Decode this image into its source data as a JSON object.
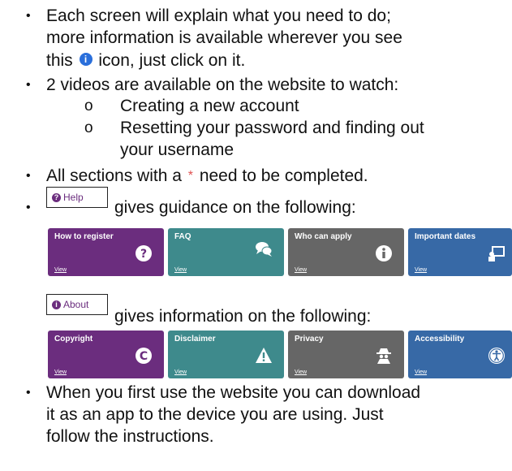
{
  "bullets": {
    "b1_line1": "Each screen will explain what you need to do;",
    "b1_line2": "more information is available wherever you see",
    "b1_line3a": "this",
    "b1_line3b": "icon, just click on it.",
    "b2": "2 videos are available on the website to watch:",
    "b2_sub1": "Creating a new account",
    "b2_sub2_line1": "Resetting your password and finding out",
    "b2_sub2_line2": "your username",
    "b3a": "All sections with a",
    "b3b": "need to be completed.",
    "b4": "gives guidance on the following:",
    "b5": "gives information on the following:",
    "b6_line1": "When you first use the website you can download",
    "b6_line2": "it as an app to the device you are using. Just",
    "b6_line3": "follow the instructions."
  },
  "symbols": {
    "bullet": "•",
    "sub_bullet": "o",
    "info_glyph": "i",
    "required_star": "*"
  },
  "help_button": {
    "label": "Help",
    "icon": "question-circle-icon",
    "glyph": "?"
  },
  "about_button": {
    "label": "About",
    "icon": "info-circle-icon",
    "glyph": "i"
  },
  "help_tiles": [
    {
      "label": "How to register",
      "link": "View",
      "icon": "question-icon",
      "color": "#6b2d7e"
    },
    {
      "label": "FAQ",
      "link": "View",
      "icon": "chat-bubbles-icon",
      "color": "#3e8a8c"
    },
    {
      "label": "Who can apply",
      "link": "View",
      "icon": "info-icon",
      "color": "#666666"
    },
    {
      "label": "Important dates",
      "link": "View",
      "icon": "presentation-icon",
      "color": "#3769a6"
    }
  ],
  "about_tiles": [
    {
      "label": "Copyright",
      "link": "View",
      "icon": "copyright-icon",
      "color": "#6b2d7e"
    },
    {
      "label": "Disclaimer",
      "link": "View",
      "icon": "warning-icon",
      "color": "#3e8a8c"
    },
    {
      "label": "Privacy",
      "link": "View",
      "icon": "spy-icon",
      "color": "#666666"
    },
    {
      "label": "Accessibility",
      "link": "View",
      "icon": "accessibility-icon",
      "color": "#3769a6"
    }
  ]
}
